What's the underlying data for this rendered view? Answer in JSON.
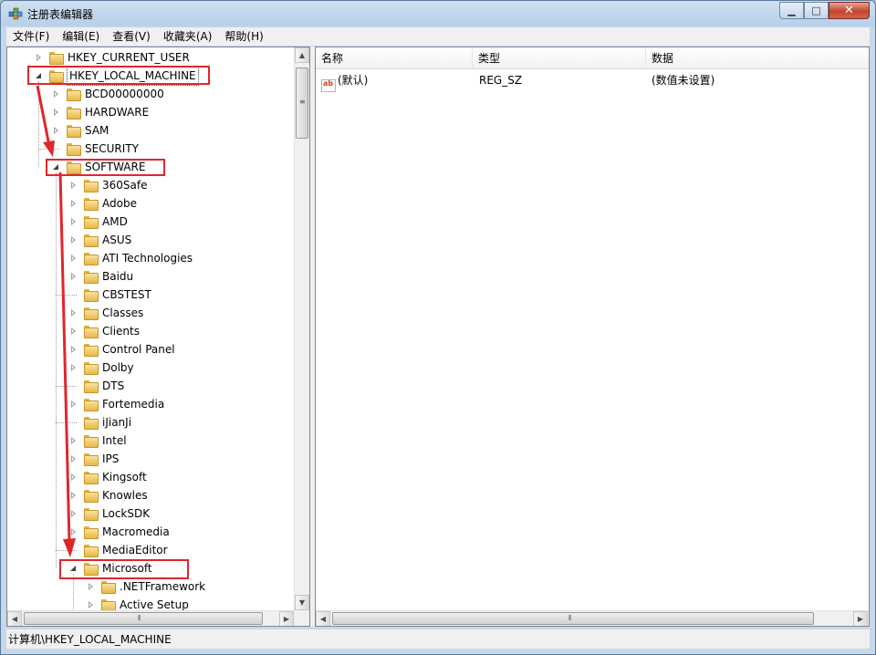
{
  "window": {
    "title": "注册表编辑器",
    "caption": {
      "minimize": "▁",
      "maximize": "□",
      "close": "✕"
    }
  },
  "menu": [
    "文件(F)",
    "编辑(E)",
    "查看(V)",
    "收藏夹(A)",
    "帮助(H)"
  ],
  "tree": {
    "items": [
      {
        "label": "HKEY_CURRENT_USER",
        "state": "collapsed",
        "level": 0
      },
      {
        "label": "HKEY_LOCAL_MACHINE",
        "state": "expanded",
        "level": 0,
        "selected": true
      },
      {
        "label": "BCD00000000",
        "state": "collapsed",
        "level": 1
      },
      {
        "label": "HARDWARE",
        "state": "collapsed",
        "level": 1
      },
      {
        "label": "SAM",
        "state": "collapsed",
        "level": 1
      },
      {
        "label": "SECURITY",
        "state": "none",
        "level": 1
      },
      {
        "label": "SOFTWARE",
        "state": "expanded",
        "level": 1
      },
      {
        "label": "360Safe",
        "state": "collapsed",
        "level": 2
      },
      {
        "label": "Adobe",
        "state": "collapsed",
        "level": 2
      },
      {
        "label": "AMD",
        "state": "collapsed",
        "level": 2
      },
      {
        "label": "ASUS",
        "state": "collapsed",
        "level": 2
      },
      {
        "label": "ATI Technologies",
        "state": "collapsed",
        "level": 2
      },
      {
        "label": "Baidu",
        "state": "collapsed",
        "level": 2
      },
      {
        "label": "CBSTEST",
        "state": "none",
        "level": 2
      },
      {
        "label": "Classes",
        "state": "collapsed",
        "level": 2
      },
      {
        "label": "Clients",
        "state": "collapsed",
        "level": 2
      },
      {
        "label": "Control Panel",
        "state": "collapsed",
        "level": 2
      },
      {
        "label": "Dolby",
        "state": "collapsed",
        "level": 2
      },
      {
        "label": "DTS",
        "state": "none",
        "level": 2
      },
      {
        "label": "Fortemedia",
        "state": "collapsed",
        "level": 2
      },
      {
        "label": "iJianJi",
        "state": "none",
        "level": 2
      },
      {
        "label": "Intel",
        "state": "collapsed",
        "level": 2
      },
      {
        "label": "IPS",
        "state": "collapsed",
        "level": 2
      },
      {
        "label": "Kingsoft",
        "state": "collapsed",
        "level": 2
      },
      {
        "label": "Knowles",
        "state": "collapsed",
        "level": 2
      },
      {
        "label": "LockSDK",
        "state": "collapsed",
        "level": 2
      },
      {
        "label": "Macromedia",
        "state": "collapsed",
        "level": 2
      },
      {
        "label": "MediaEditor",
        "state": "none",
        "level": 2
      },
      {
        "label": "Microsoft",
        "state": "expanded",
        "level": 2
      },
      {
        "label": ".NETFramework",
        "state": "collapsed",
        "level": 3
      },
      {
        "label": "Active Setup",
        "state": "collapsed",
        "level": 3
      }
    ]
  },
  "list": {
    "columns": [
      "名称",
      "类型",
      "数据"
    ],
    "rows": [
      {
        "name": "(默认)",
        "type": "REG_SZ",
        "data": "(数值未设置)",
        "icon": "ab-icon"
      }
    ]
  },
  "statusbar": {
    "path": "计算机\\HKEY_LOCAL_MACHINE"
  },
  "annotation_color": "#e0262d"
}
